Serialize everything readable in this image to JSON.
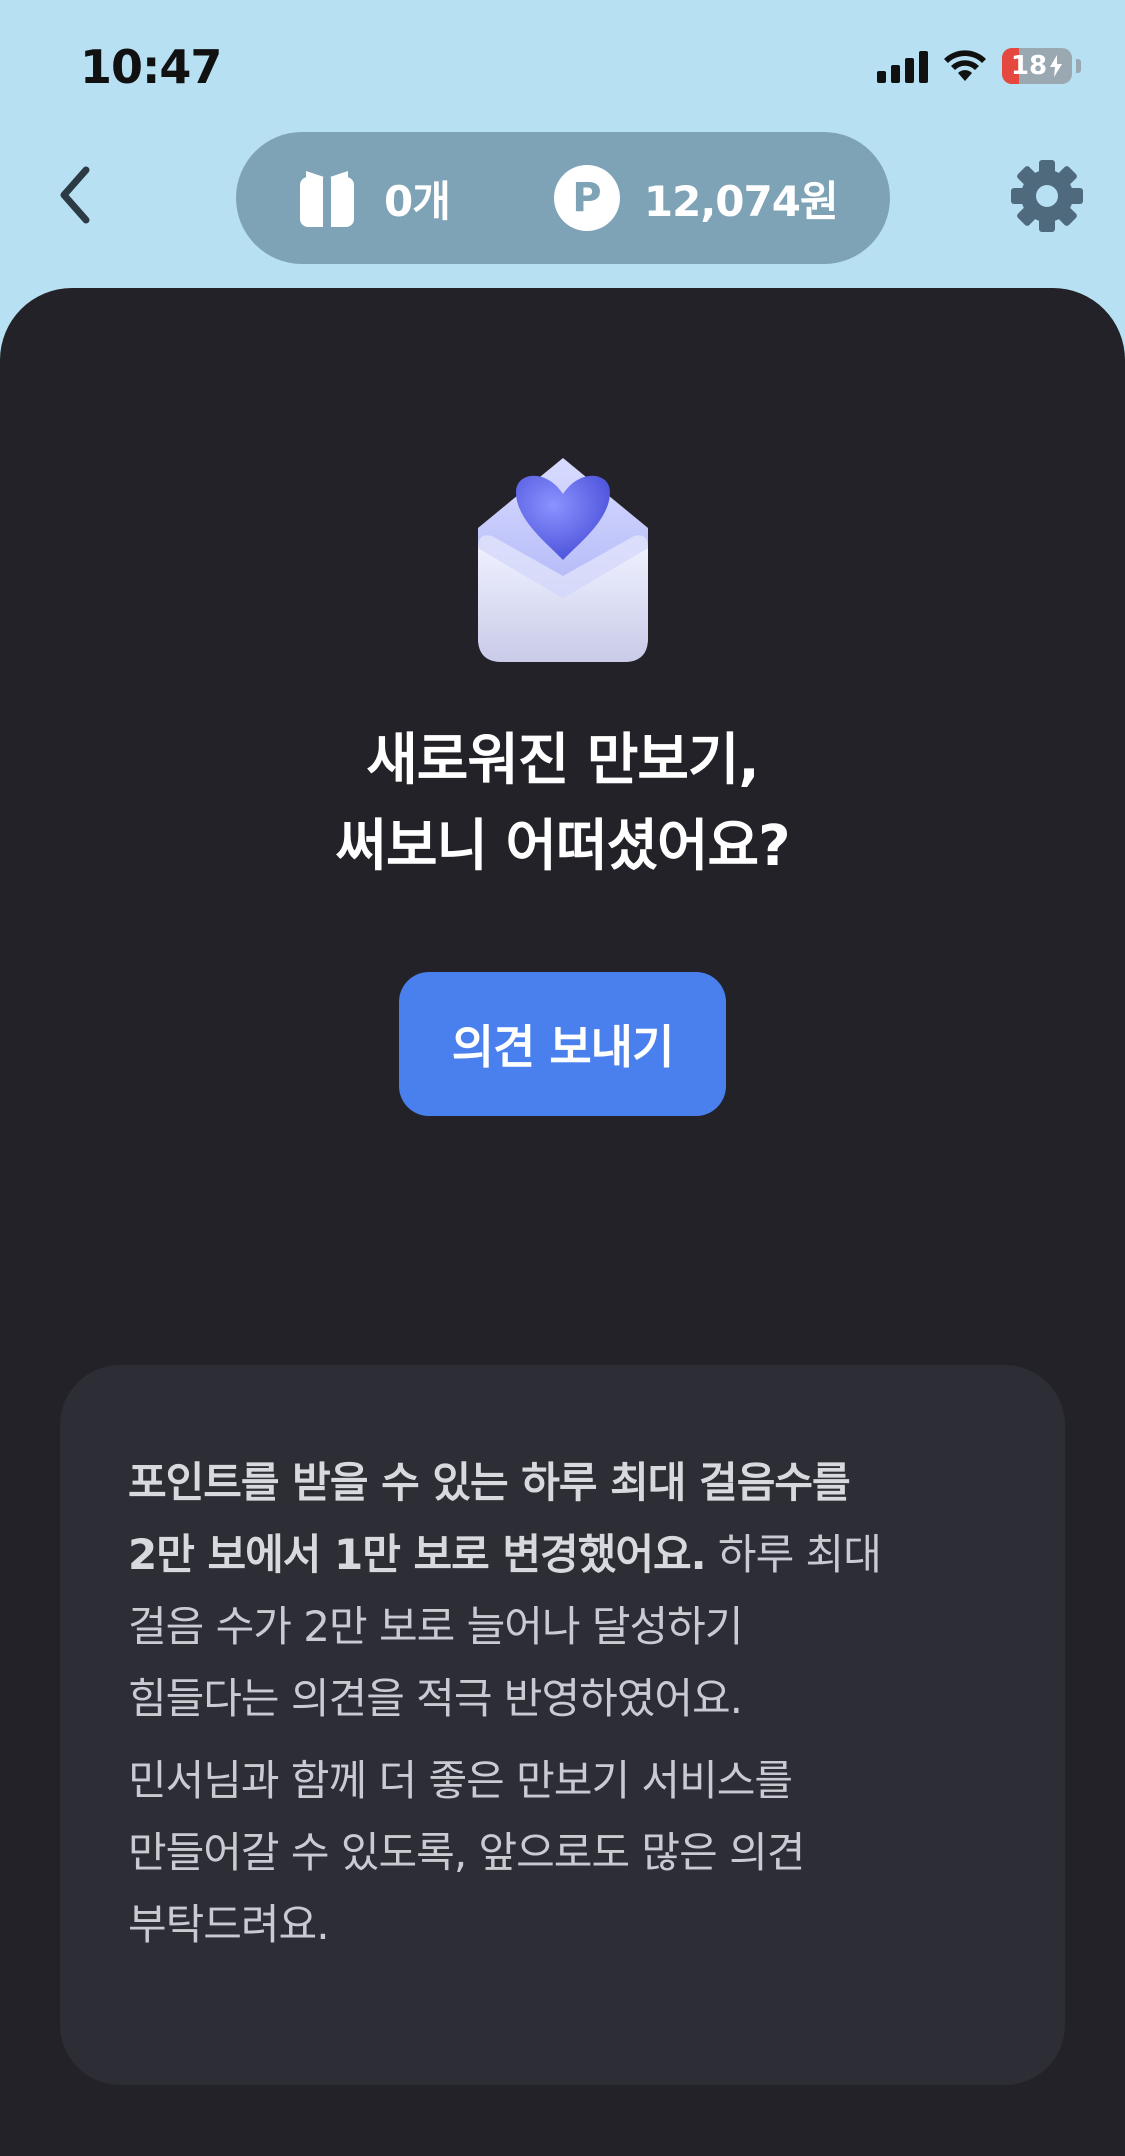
{
  "status_bar": {
    "time": "10:47",
    "battery": "18"
  },
  "header": {
    "gift_count": "0개",
    "points": "12,074원",
    "point_symbol": "P"
  },
  "main": {
    "headline_line1": "새로워진 만보기,",
    "headline_line2": "써보니 어떠셨어요?",
    "feedback_button": "의견 보내기"
  },
  "notice": {
    "p1_bold_line1": "포인트를 받을 수 있는 하루 최대 걸음수를",
    "p1_bold_line2": "2만 보에서 1만 보로 변경했어요.",
    "p1_rest_tail": " 하루 최대",
    "p1_line3": "걸음 수가 2만 보로 늘어나 달성하기",
    "p1_line4": "힘들다는 의견을 적극 반영하였어요.",
    "p2_line1": "민서님과 함께 더 좋은 만보기 서비스를",
    "p2_line2": "만들어갈 수 있도록, 앞으로도 많은 의견",
    "p2_line3": "부탁드려요."
  },
  "colors": {
    "background": "#b7e0f2",
    "panel": "#222228",
    "card": "#2c2d35",
    "button": "#4a80ee",
    "pill": "#7fa3b6"
  },
  "icons": [
    "back-chevron-icon",
    "gift-icon",
    "point-icon",
    "gear-icon",
    "envelope-heart-icon",
    "signal-icon",
    "wifi-icon",
    "battery-icon"
  ]
}
